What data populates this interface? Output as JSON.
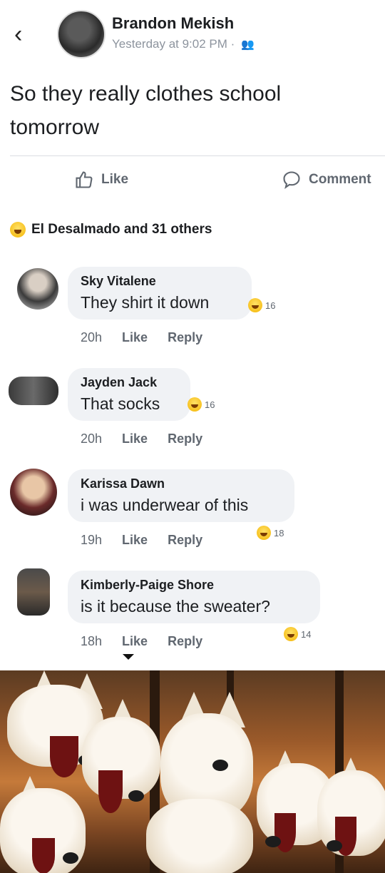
{
  "post": {
    "author": "Brandon Mekish",
    "timestamp": "Yesterday at 9:02 PM",
    "separator": "·",
    "audience_icon": "friends-icon",
    "text": "So they really clothes school tomorrow"
  },
  "actions": {
    "like_label": "Like",
    "comment_label": "Comment"
  },
  "reactions": {
    "summary": "El Desalmado and 31 others",
    "icon": "haha-icon"
  },
  "comments": [
    {
      "name": "Sky Vitalene",
      "text": "They shirt it down",
      "time": "20h",
      "like": "Like",
      "reply": "Reply",
      "reaction_count": "16"
    },
    {
      "name": "Jayden Jack",
      "text": "That socks",
      "time": "20h",
      "like": "Like",
      "reply": "Reply",
      "reaction_count": "16"
    },
    {
      "name": "Karissa Dawn",
      "text": "i was underwear of this",
      "time": "19h",
      "like": "Like",
      "reply": "Reply",
      "reaction_count": "18"
    },
    {
      "name": "Kimberly-Paige Shore",
      "text": "is it because the sweater?",
      "time": "18h",
      "like": "Like",
      "reply": "Reply",
      "reaction_count": "14"
    }
  ],
  "colors": {
    "bubble": "#f0f2f5",
    "meta_text": "#8d949e",
    "action_text": "#606770"
  }
}
